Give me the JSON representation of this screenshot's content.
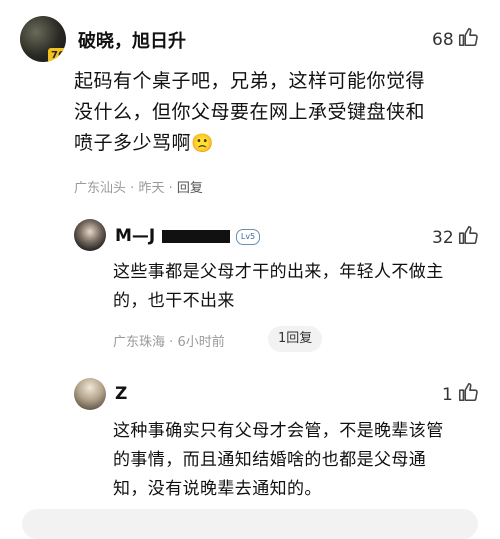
{
  "comment": {
    "user_name": "破晓，旭日升",
    "likes": "68",
    "text_line1": "起码有个桌子吧，兄弟，这样可能你觉得",
    "text_line2": "没什么，但你父母要在网上承受键盘侠和",
    "text_line3": "喷子多少骂啊",
    "emoji": "🙁",
    "location": "广东汕头",
    "time": "昨天",
    "reply_label": "回复",
    "avatar_badge": "76"
  },
  "replies": [
    {
      "user_name": "M—J",
      "level_badge": "Lv5",
      "likes": "32",
      "text_line1": "这些事都是父母才干的出来，年轻人不做主",
      "text_line2": "的，也干不出来",
      "location": "广东珠海",
      "time": "6小时前",
      "reply_count_label": "1回复"
    },
    {
      "user_name": "Z",
      "likes": "1",
      "text_line1": "这种事确实只有父母才会管，不是晚辈该管",
      "text_line2": "的事情，而且通知结婚啥的也都是父母通",
      "text_line3": "知，没有说晚辈去通知的。"
    }
  ],
  "separator": "·",
  "colors": {
    "meta": "#9a9a9a",
    "pill_bg": "#f2f2f2",
    "text": "#111111"
  }
}
